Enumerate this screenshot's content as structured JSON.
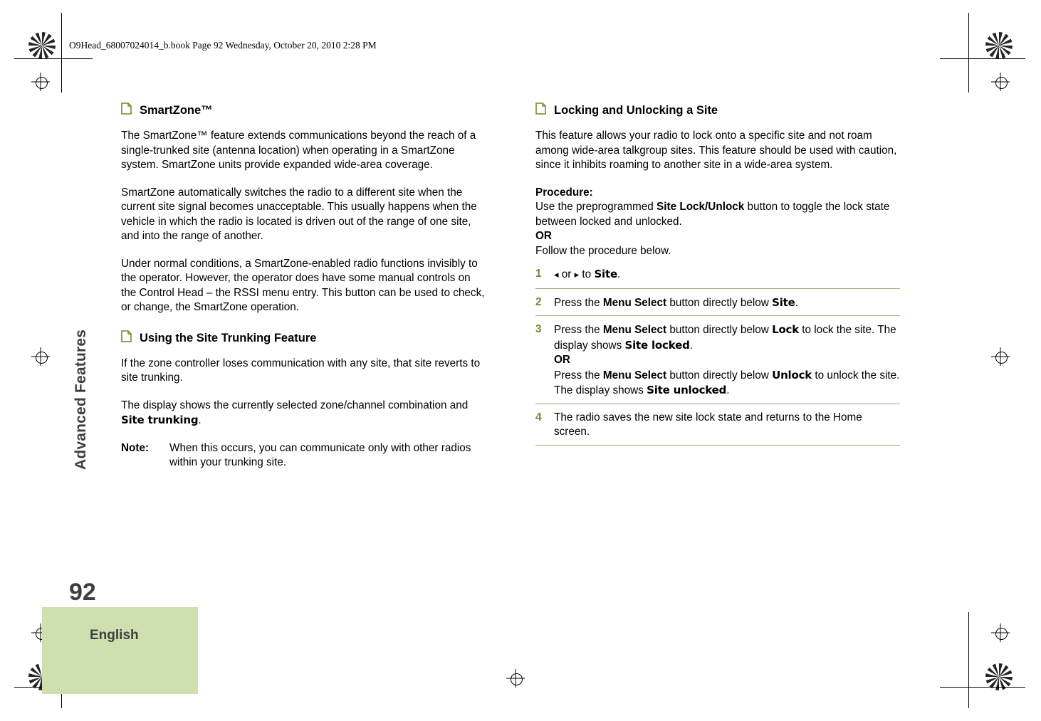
{
  "header": {
    "file_line": "O9Head_68007024014_b.book  Page 92  Wednesday, October 20, 2010  2:28 PM"
  },
  "side_tab": {
    "chapter_label": "Advanced Features",
    "page_number": "92",
    "language": "English"
  },
  "left_column": {
    "heading1": "SmartZone™",
    "para1": "The SmartZone™ feature extends communications beyond the reach of a single-trunked site (antenna location) when operating in a SmartZone system. SmartZone units provide expanded wide-area coverage.",
    "para2": "SmartZone automatically switches the radio to a different site when the current site signal becomes unacceptable. This usually happens when the vehicle in which the radio is located is driven out of the range of one site, and into the range of another.",
    "para3": "Under normal conditions, a SmartZone-enabled radio functions invisibly to the operator. However, the operator does have some manual controls on the Control Head – the RSSI menu entry. This button can be used to check, or change, the SmartZone operation.",
    "heading2": "Using the Site Trunking Feature",
    "para4": "If the zone controller loses communication with any site, that site reverts to site trunking.",
    "para5_prefix": "The display shows the currently selected zone/channel combination and ",
    "para5_display": "Site trunking",
    "para5_suffix": ".",
    "note_label": "Note:",
    "note_text": "When this occurs, you can communicate only with other radios within your trunking site."
  },
  "right_column": {
    "heading1": "Locking and Unlocking a Site",
    "para1": "This feature allows your radio to lock onto a specific site and not roam among wide-area talkgroup sites. This feature should be used with caution, since it inhibits roaming to another site in a wide-area system.",
    "procedure_label": "Procedure:",
    "procedure_line1_a": "Use the preprogrammed ",
    "procedure_line1_bold": "Site Lock/Unlock",
    "procedure_line1_b": " button to toggle the lock state between locked and unlocked.",
    "procedure_or": "OR",
    "procedure_line2": "Follow the procedure below.",
    "steps": [
      {
        "num": "1",
        "left_arrow": "◂",
        "mid": " or ",
        "right_arrow": "▸",
        "to": " to ",
        "display": "Site",
        "tail": "."
      },
      {
        "num": "2",
        "a": "Press the ",
        "bold": "Menu Select",
        "b": " button directly below ",
        "display": "Site",
        "tail": "."
      },
      {
        "num": "3",
        "a": "Press the ",
        "bold": "Menu Select",
        "b": " button directly below ",
        "display": "Lock",
        "c": " to lock the site. The display shows ",
        "display2": "Site locked",
        "tail": ".",
        "or": "OR",
        "d": "Press the ",
        "bold2": "Menu Select",
        "e": " button directly below ",
        "display3": "Unlock",
        "f": " to unlock the site. The display shows ",
        "display4": "Site unlocked",
        "tail2": "."
      },
      {
        "num": "4",
        "text": "The radio saves the new site lock state and returns to the Home screen."
      }
    ]
  },
  "colors": {
    "accent_green": "#cedfb0",
    "rule_green": "#9aab6e",
    "number_green": "#6f8b2f",
    "chapter_gray": "#3f3f3f"
  }
}
